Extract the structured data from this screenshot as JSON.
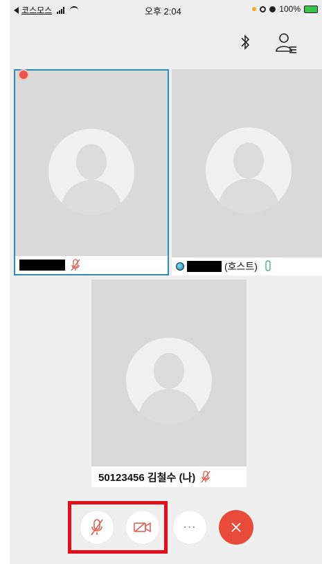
{
  "status_bar": {
    "carrier": "코스모스",
    "time": "오후 2:04",
    "battery": "100%"
  },
  "top_bar": {
    "icons": [
      "bluetooth-icon",
      "participants-icon"
    ]
  },
  "tiles": [
    {
      "name_redacted": true,
      "mic": "muted",
      "active_speaker": true
    },
    {
      "name_redacted": true,
      "host_label": "(호스트)",
      "mic": "on"
    },
    {
      "name": "50123456 김철수 (나)",
      "mic": "muted"
    }
  ],
  "controls": {
    "more_label": "···",
    "buttons": [
      "mute-mic-icon",
      "video-off-icon",
      "more-icon",
      "end-call-icon"
    ]
  },
  "colors": {
    "highlight": "#e20e1b",
    "end_call": "#e94b3a",
    "active_border": "#2e8db8",
    "muted_red": "#e0574a",
    "mic_green": "#3fbf6a"
  }
}
